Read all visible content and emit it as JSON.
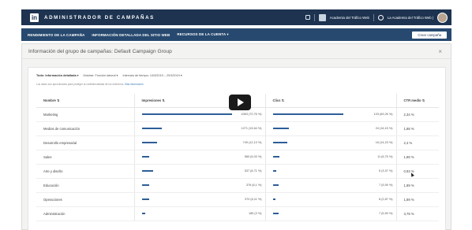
{
  "app": {
    "logo": "in",
    "title": "ADMINISTRADOR DE CAMPAÑAS"
  },
  "account": {
    "name": "Academia del Tráfico Web",
    "selector": "La Academia del Tráfico Web |"
  },
  "nav": {
    "items": [
      "RENDIMIENTO DE LA CAMPAÑA",
      "INFORMACIÓN DETALLADA DEL SITIO WEB",
      "RECURSOS DE LA CUENTA ▾"
    ],
    "create_button": "Crear campaña"
  },
  "panel": {
    "title": "Información del grupo de campañas: Default Campaign Group",
    "close": "×"
  },
  "filters": {
    "view": "Todo: información detallada ▾",
    "show": "Mostrar: Función laboral ▾",
    "range": "Intervalo de tiempo: 14/3/2019 – 20/3/2019 ▾"
  },
  "note": {
    "text": "Los datos son aproximados para proteger la confidencialidad de los miembros.",
    "link": "Más información"
  },
  "table": {
    "headers": [
      "Nombre ⇅",
      "Impresiones ⇅",
      "Clics ⇅",
      "CTR medio ⇅"
    ],
    "rows": [
      {
        "name": "Marketing",
        "impr": "4363 (70,76 %)",
        "impr_pct": 70.76,
        "clicks": "103 (69,26 %)",
        "clicks_pct": 69.26,
        "ctr": "2,34 %"
      },
      {
        "name": "Medios de comunicación",
        "impr": "1271 (15,64 %)",
        "impr_pct": 15.64,
        "clicks": "24 (16,15 %)",
        "clicks_pct": 16.15,
        "ctr": "1,88 %"
      },
      {
        "name": "Desarrollo empresarial",
        "impr": "749 (12,13 %)",
        "impr_pct": 12.13,
        "clicks": "16 (14,23 %)",
        "clicks_pct": 14.23,
        "ctr": "2,4 %"
      },
      {
        "name": "Sales",
        "impr": "580 (6,03 %)",
        "impr_pct": 6.03,
        "clicks": "11 (6,75 %)",
        "clicks_pct": 6.75,
        "ctr": "1,88 %"
      },
      {
        "name": "Arte y diseño",
        "impr": "537 (8,71 %)",
        "impr_pct": 8.71,
        "clicks": "5 (3,37 %)",
        "clicks_pct": 3.37,
        "ctr": "0,93 %"
      },
      {
        "name": "Educación",
        "impr": "376 (6,1 %)",
        "impr_pct": 6.1,
        "clicks": "7 (5,59 %)",
        "clicks_pct": 5.59,
        "ctr": "1,89 %"
      },
      {
        "name": "Operaciones",
        "impr": "370 (6,11 %)",
        "impr_pct": 6.11,
        "clicks": "8 (2,87 %)",
        "clicks_pct": 2.87,
        "ctr": "1,89 %"
      },
      {
        "name": "Administración",
        "impr": "185 (3 %)",
        "impr_pct": 3,
        "clicks": "7 (5,59 %)",
        "clicks_pct": 5.59,
        "ctr": "3,78 %"
      }
    ]
  },
  "colors": {
    "topbar": "#1d3350",
    "navbar": "#27496f",
    "bar": "#2d5e98"
  }
}
